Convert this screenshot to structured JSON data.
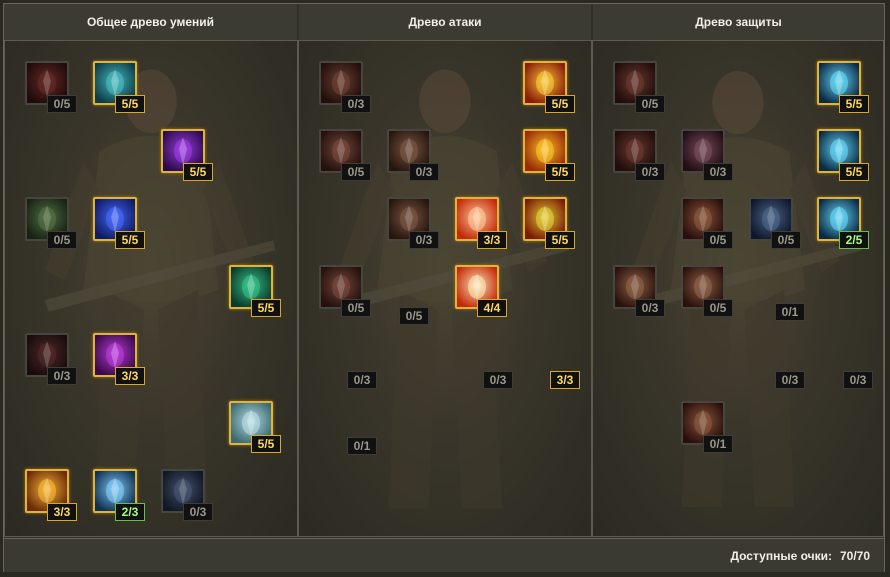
{
  "tabs": [
    {
      "title": "Общее древо умений"
    },
    {
      "title": "Древо атаки"
    },
    {
      "title": "Древо защиты"
    }
  ],
  "footer": {
    "label": "Доступные очки:",
    "value": "70/70"
  },
  "trees": {
    "general": [
      {
        "icon": "red-figure-icon",
        "rank": "0/5",
        "state": "empty",
        "c1": "#b42a1f",
        "c2": "#3a0906"
      },
      {
        "icon": "cyan-figure-icon",
        "rank": "5/5",
        "state": "max",
        "c1": "#4fc2c7",
        "c2": "#0c3d4a"
      },
      {
        "icon": "purple-figure-icon",
        "rank": "5/5",
        "state": "max",
        "c1": "#a240e8",
        "c2": "#2b0a4f"
      },
      {
        "icon": "green-cross-icon",
        "rank": "0/5",
        "state": "empty",
        "c1": "#5c9b36",
        "c2": "#13300d"
      },
      {
        "icon": "blue-orb-icon",
        "rank": "5/5",
        "state": "max",
        "c1": "#4a6cff",
        "c2": "#0e1b66"
      },
      {
        "icon": "green-wizard-icon",
        "rank": "5/5",
        "state": "max",
        "c1": "#39c98e",
        "c2": "#0a3a2b"
      },
      {
        "icon": "crimson-cross-icon",
        "rank": "0/3",
        "state": "empty",
        "c1": "#8a2c2c",
        "c2": "#2a0b0b"
      },
      {
        "icon": "magenta-orb-icon",
        "rank": "3/3",
        "state": "max",
        "c1": "#c03ee0",
        "c2": "#3a0a4a"
      },
      {
        "icon": "wind-swirl-icon",
        "rank": "5/5",
        "state": "max",
        "c1": "#bfe3e8",
        "c2": "#3a6a72"
      },
      {
        "icon": "gold-rune-icon",
        "rank": "3/3",
        "state": "max",
        "c1": "#ffbe3a",
        "c2": "#6a2a05"
      },
      {
        "icon": "ice-tree-icon",
        "rank": "2/3",
        "state": "partial",
        "c1": "#8ad3ff",
        "c2": "#0e3052"
      },
      {
        "icon": "blue-tree-icon",
        "rank": "0/3",
        "state": "empty",
        "c1": "#4d6fb0",
        "c2": "#0f1d3a"
      }
    ],
    "attack": [
      {
        "icon": "red-eye-icon",
        "rank": "0/3",
        "state": "empty",
        "c1": "#b44a2a",
        "c2": "#3a0f06"
      },
      {
        "icon": "golden-spear-icon",
        "rank": "5/5",
        "state": "max",
        "c1": "#ffd23a",
        "c2": "#8a1a06"
      },
      {
        "icon": "red-burst-icon",
        "rank": "0/5",
        "state": "empty",
        "c1": "#c4543a",
        "c2": "#3e1006"
      },
      {
        "icon": "red-spikes-icon",
        "rank": "0/3",
        "state": "empty",
        "c1": "#c06a3a",
        "c2": "#3e1808"
      },
      {
        "icon": "golden-sword-icon",
        "rank": "5/5",
        "state": "max",
        "c1": "#ffcc2a",
        "c2": "#9a2a05"
      },
      {
        "icon": "red-claws-icon",
        "rank": "0/3",
        "state": "empty",
        "c1": "#c06a3a",
        "c2": "#3e1808"
      },
      {
        "icon": "flame-star-icon",
        "rank": "3/3",
        "state": "max",
        "c1": "#ffd0a0",
        "c2": "#c42a0a"
      },
      {
        "icon": "golden-fist-icon",
        "rank": "5/5",
        "state": "max",
        "c1": "#e8d83a",
        "c2": "#7a1a05"
      },
      {
        "icon": "red-flare-icon",
        "rank": "0/5",
        "state": "empty",
        "c1": "#c4543a",
        "c2": "#3e1006"
      },
      {
        "icon": "flame-nova-icon",
        "rank": "4/4",
        "state": "max",
        "c1": "#fff0c0",
        "c2": "#c42a0a"
      }
    ],
    "attack_badges": [
      {
        "rank": "0/5",
        "state": "empty"
      },
      {
        "rank": "0/3",
        "state": "empty"
      },
      {
        "rank": "0/3",
        "state": "empty"
      },
      {
        "rank": "3/3",
        "state": "max"
      },
      {
        "rank": "0/1",
        "state": "empty"
      }
    ],
    "defense": [
      {
        "icon": "red-shield-icon",
        "rank": "0/5",
        "state": "empty",
        "c1": "#b4402a",
        "c2": "#3a0c06"
      },
      {
        "icon": "lightning-icon",
        "rank": "5/5",
        "state": "max",
        "c1": "#6ae0ff",
        "c2": "#0a2a46"
      },
      {
        "icon": "red-tree-icon",
        "rank": "0/3",
        "state": "empty",
        "c1": "#b4402a",
        "c2": "#3a0c06"
      },
      {
        "icon": "pink-slash-icon",
        "rank": "0/3",
        "state": "empty",
        "c1": "#c05a7a",
        "c2": "#3a0c1e"
      },
      {
        "icon": "lightning-blade-icon",
        "rank": "5/5",
        "state": "max",
        "c1": "#6ae0ff",
        "c2": "#0a2a46"
      },
      {
        "icon": "fire-tree-icon",
        "rank": "0/5",
        "state": "empty",
        "c1": "#e06a2a",
        "c2": "#4a0c04"
      },
      {
        "icon": "blue-shield-icon",
        "rank": "0/5",
        "state": "empty",
        "c1": "#4a8ae0",
        "c2": "#0a1e4a"
      },
      {
        "icon": "spark-shield-icon",
        "rank": "2/5",
        "state": "partial",
        "c1": "#6ae0ff",
        "c2": "#0a2a46"
      },
      {
        "icon": "flame-shield-icon",
        "rank": "0/3",
        "state": "empty",
        "c1": "#e0783a",
        "c2": "#4a1004"
      },
      {
        "icon": "fire-crest-icon",
        "rank": "0/5",
        "state": "empty",
        "c1": "#e0783a",
        "c2": "#4a1004"
      },
      {
        "icon": "ember-tree-icon",
        "rank": "0/1",
        "state": "empty",
        "c1": "#e06a2a",
        "c2": "#4a0c04"
      }
    ],
    "defense_badges": [
      {
        "rank": "0/1",
        "state": "empty"
      },
      {
        "rank": "0/3",
        "state": "empty"
      },
      {
        "rank": "0/3",
        "state": "empty"
      }
    ]
  }
}
